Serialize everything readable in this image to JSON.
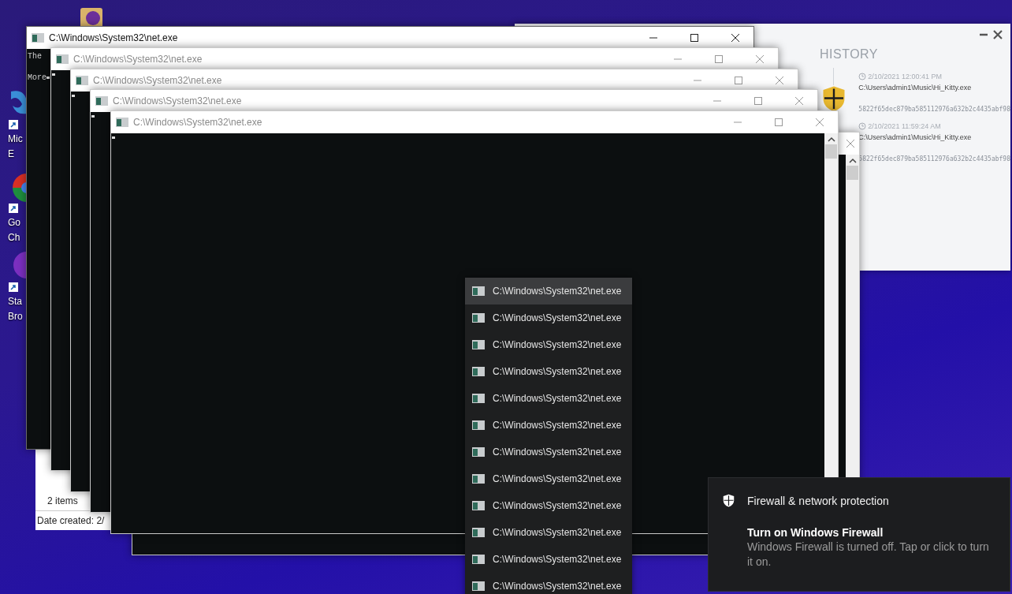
{
  "desktop_icons": [
    {
      "kind": "edge",
      "lines": [
        "Mic",
        "E"
      ]
    },
    {
      "kind": "chrome",
      "lines": [
        "Go",
        "Ch"
      ]
    },
    {
      "kind": "browser",
      "lines": [
        "Sta",
        "Bro"
      ]
    }
  ],
  "history": {
    "title": "HISTORY",
    "entries": [
      {
        "time": "2/10/2021 12:00:41 PM",
        "path": "C:\\Users\\admin1\\Music\\Hi_Kitty.exe",
        "hash": "5822f65dec879ba585112976a632b2c4435abf98"
      },
      {
        "time": "2/10/2021 11:59:24 AM",
        "path": "C:\\Users\\admin1\\Music\\Hi_Kitty.exe",
        "hash": "5822f65dec879ba585112976a632b2c4435abf98"
      }
    ]
  },
  "explorer": {
    "status_count": "2 items",
    "status_detail": "Date created: 2/"
  },
  "console_windows": [
    {
      "title": "C:\\Windows\\System32\\net.exe",
      "active": true,
      "lines": [
        "The",
        "More"
      ]
    },
    {
      "title": "C:\\Windows\\System32\\net.exe",
      "active": false
    },
    {
      "title": "C:\\Windows\\System32\\net.exe",
      "active": false
    },
    {
      "title": "C:\\Windows\\System32\\net.exe",
      "active": false
    },
    {
      "title": "C:\\Windows\\System32\\net.exe",
      "active": false
    }
  ],
  "jump_list": {
    "items": [
      {
        "label": "C:\\Windows\\System32\\net.exe",
        "selected": true
      },
      {
        "label": "C:\\Windows\\System32\\net.exe",
        "selected": false
      },
      {
        "label": "C:\\Windows\\System32\\net.exe",
        "selected": false
      },
      {
        "label": "C:\\Windows\\System32\\net.exe",
        "selected": false
      },
      {
        "label": "C:\\Windows\\System32\\net.exe",
        "selected": false
      },
      {
        "label": "C:\\Windows\\System32\\net.exe",
        "selected": false
      },
      {
        "label": "C:\\Windows\\System32\\net.exe",
        "selected": false
      },
      {
        "label": "C:\\Windows\\System32\\net.exe",
        "selected": false
      },
      {
        "label": "C:\\Windows\\System32\\net.exe",
        "selected": false
      },
      {
        "label": "C:\\Windows\\System32\\net.exe",
        "selected": false
      },
      {
        "label": "C:\\Windows\\System32\\net.exe",
        "selected": false
      },
      {
        "label": "C:\\Windows\\System32\\net.exe",
        "selected": false
      }
    ]
  },
  "toast": {
    "header": "Firewall & network protection",
    "title": "Turn on Windows Firewall",
    "body": "Windows Firewall is turned off. Tap or click to turn it on."
  }
}
